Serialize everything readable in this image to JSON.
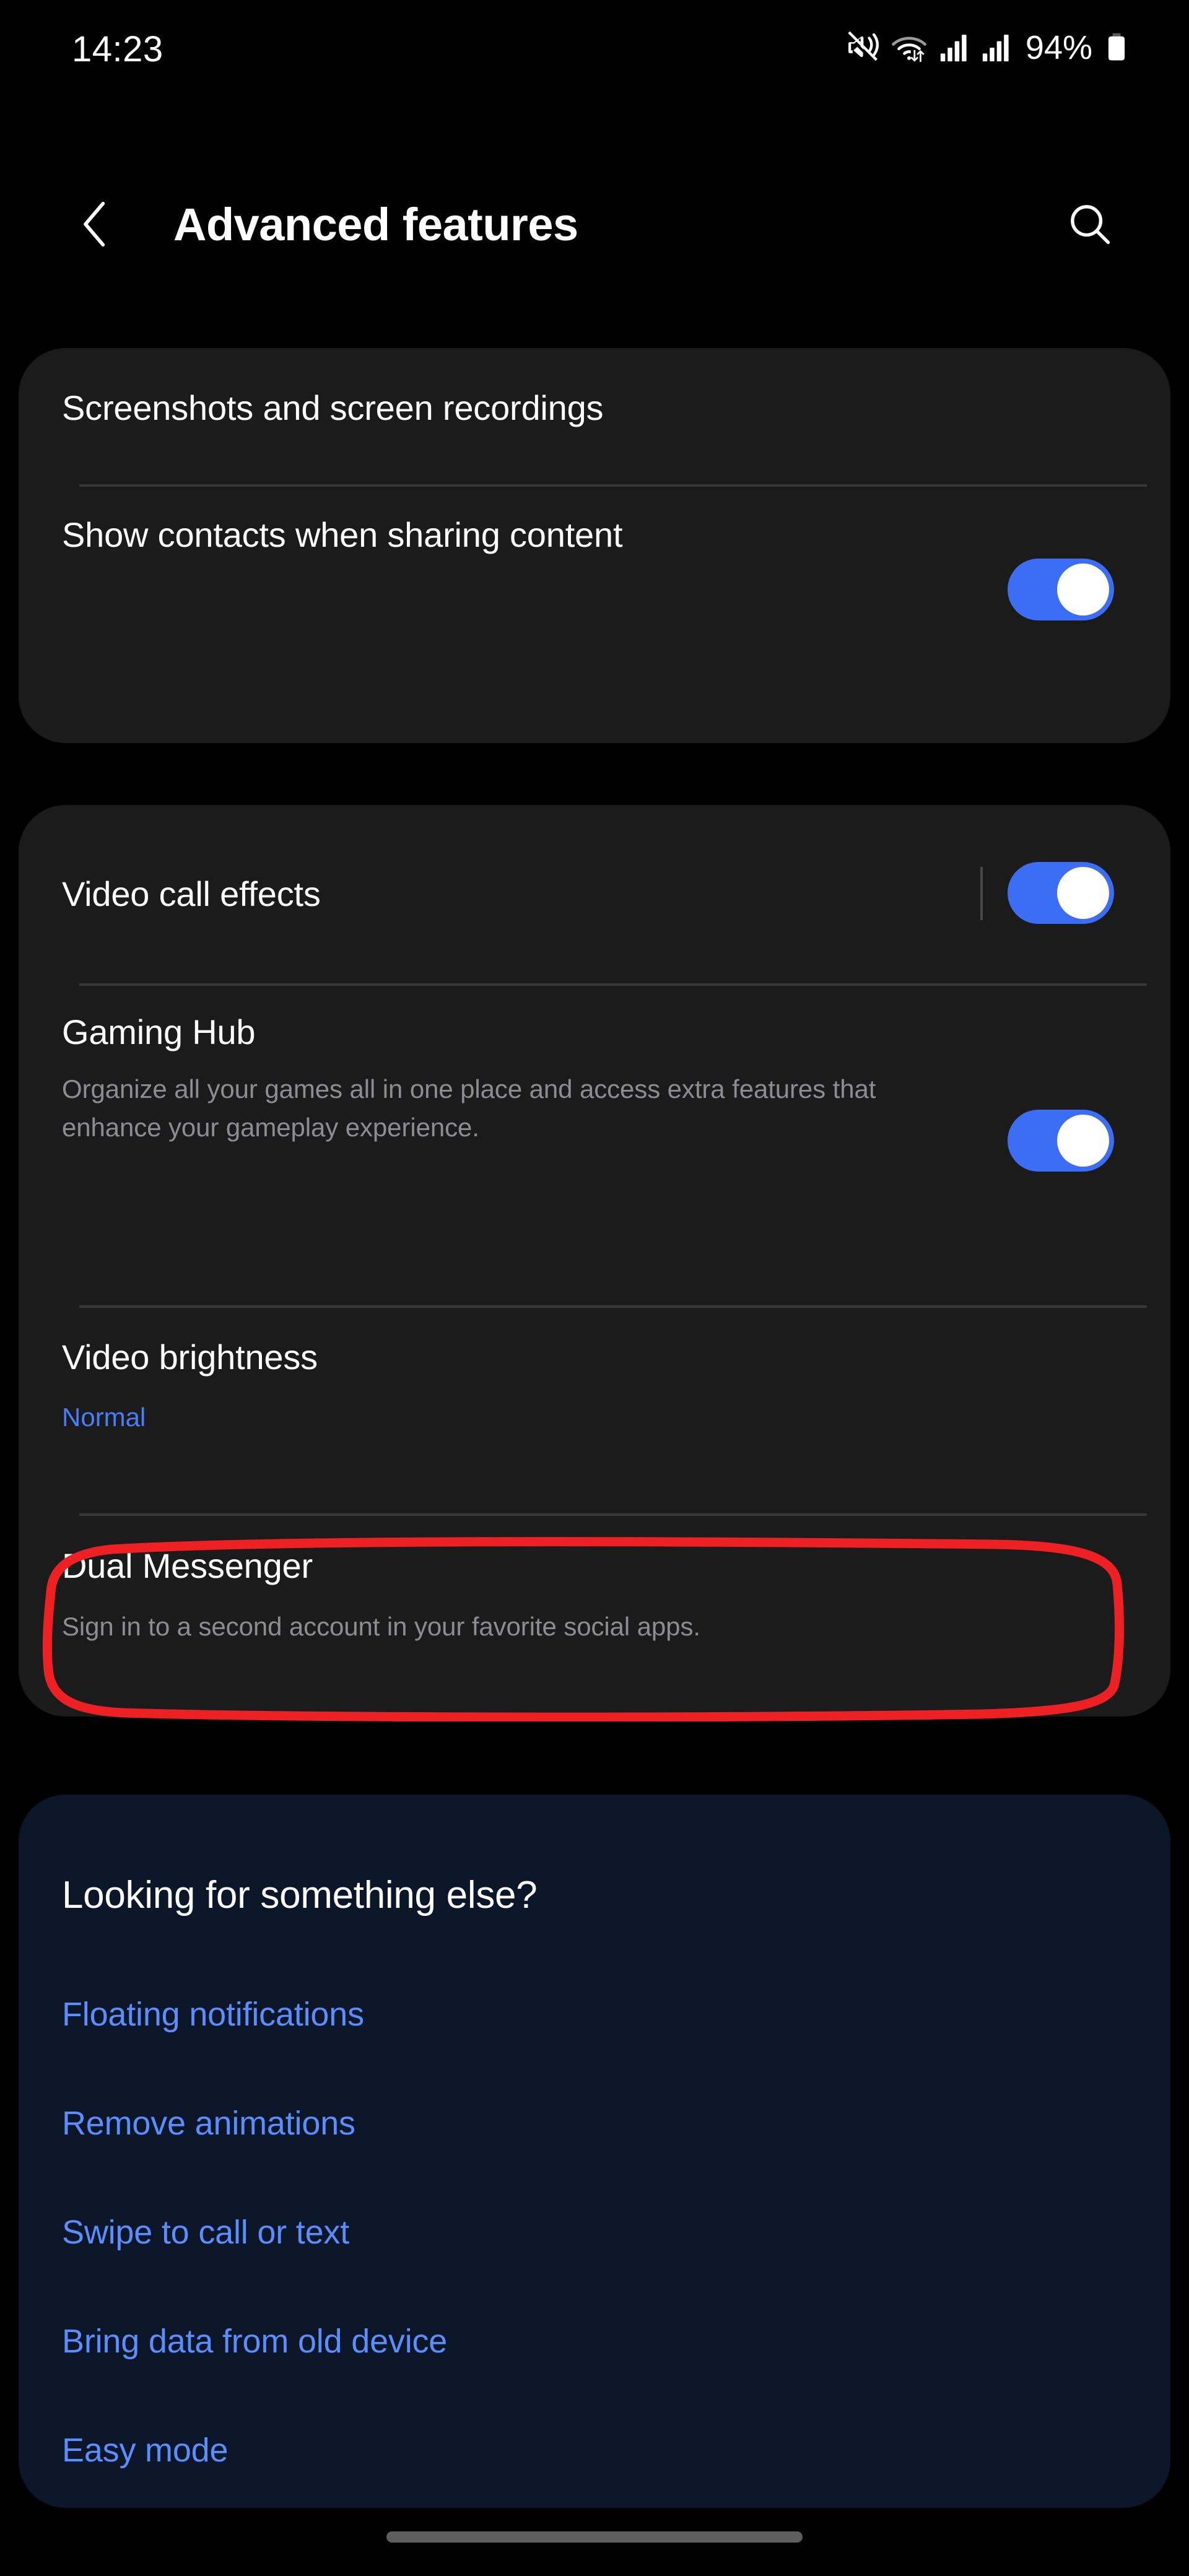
{
  "status_bar": {
    "time": "14:23",
    "battery_percent": "94%",
    "icons": [
      "mute-vibrate-icon",
      "wifi-icon",
      "signal-bars-icon",
      "signal-bars-icon",
      "battery-icon"
    ]
  },
  "app_bar": {
    "back_icon": "chevron-left-icon",
    "title": "Advanced features",
    "search_icon": "search-icon"
  },
  "cards": {
    "card1": {
      "rows": [
        {
          "title": "Screenshots and screen recordings"
        },
        {
          "title": "Show contacts when sharing content",
          "toggle": "on"
        }
      ]
    },
    "card2": {
      "rows": [
        {
          "title": "Video call effects",
          "toggle": "on"
        },
        {
          "title": "Gaming Hub",
          "desc": "Organize all your games all in one place and access extra features that enhance your gameplay experience.",
          "toggle": "on"
        },
        {
          "title": "Video brightness",
          "value": "Normal"
        },
        {
          "title": "Dual Messenger",
          "desc": "Sign in to a second account in your favorite social apps.",
          "highlighted": "true"
        }
      ]
    },
    "promo": {
      "heading": "Looking for something else?",
      "links": [
        "Floating notifications",
        "Remove animations",
        "Swipe to call or text",
        "Bring data from old device",
        "Easy mode"
      ]
    }
  },
  "annotation": {
    "shape": "rounded-rectangle-highlight",
    "color": "#ed2024",
    "targets": "Dual Messenger"
  },
  "colors": {
    "background": "#000000",
    "card": "#1b1b1c",
    "promo_card": "#0b1629",
    "toggle_on": "#3c6ef5",
    "link": "#5b8dfc",
    "value_text": "#4a7dfb",
    "secondary_text": "#8d8d91",
    "annotation_red": "#ed2024"
  },
  "nav_bar": {
    "home_indicator": "home-indicator"
  }
}
